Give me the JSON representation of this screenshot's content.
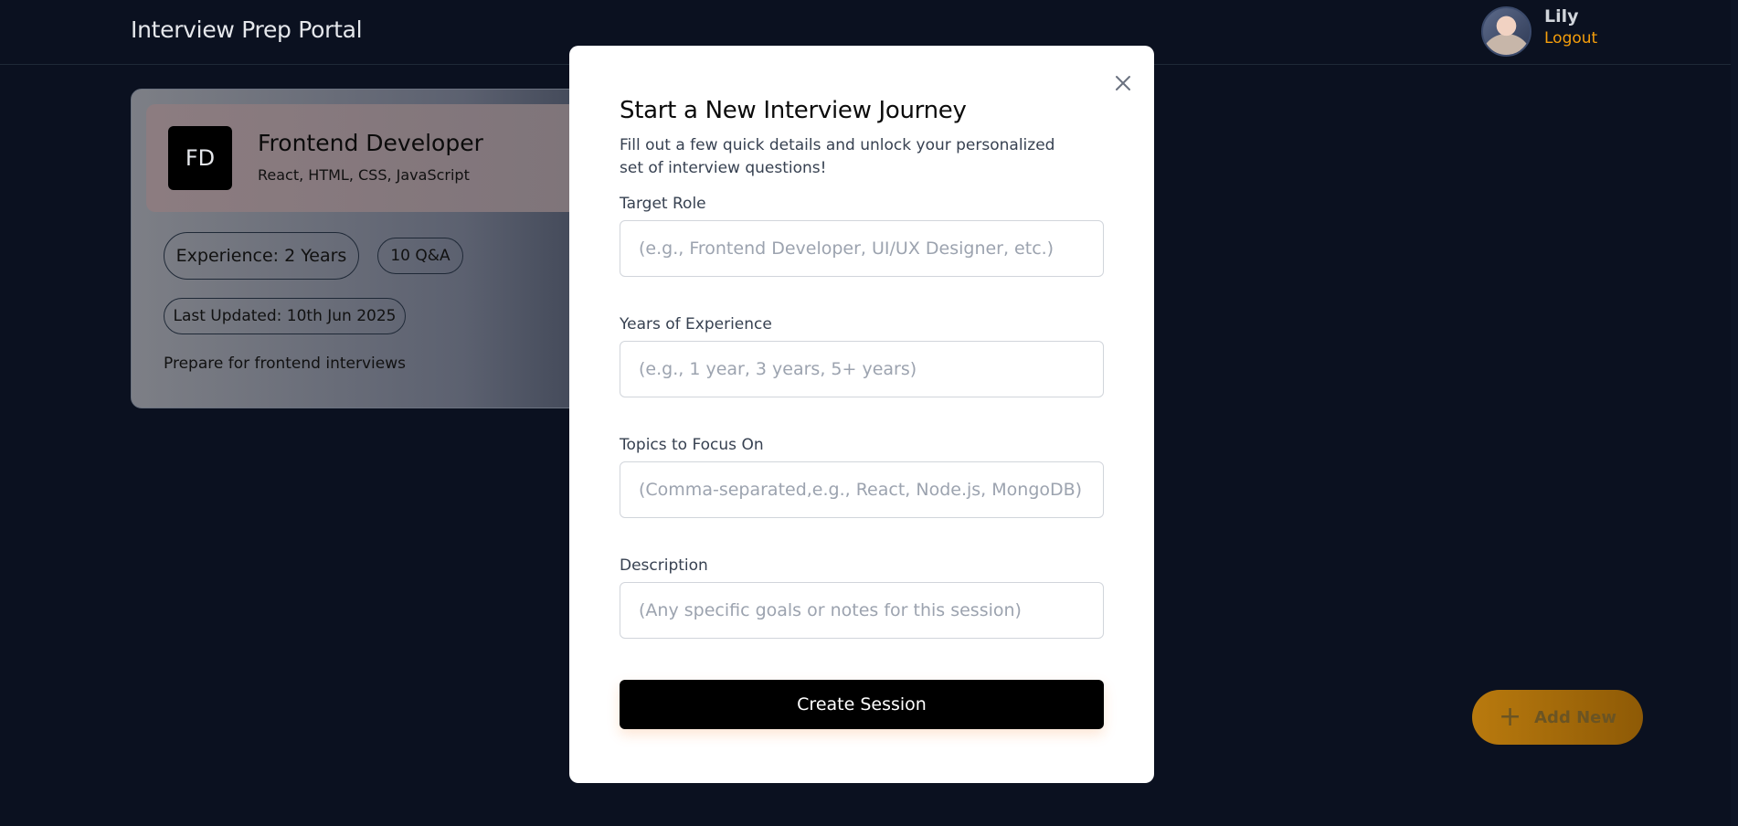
{
  "header": {
    "brand": "Interview Prep Portal",
    "user_name": "Lily",
    "logout_label": "Logout"
  },
  "session_card": {
    "initials": "FD",
    "title": "Frontend Developer",
    "topics": "React, HTML, CSS, JavaScript",
    "experience": "Experience: 2 Years",
    "qa_count": "10 Q&A",
    "last_updated": "Last Updated: 10th Jun 2025",
    "description": "Prepare for frontend interviews"
  },
  "add_new": {
    "icon": "plus-icon",
    "label": "Add New"
  },
  "modal": {
    "title": "Start a New Interview Journey",
    "subtitle": "Fill out a few quick details and unlock your personalized set of interview questions!",
    "close_icon": "close-icon",
    "fields": [
      {
        "label": "Target Role",
        "placeholder": "(e.g., Frontend Developer, UI/UX Designer, etc.)",
        "value": ""
      },
      {
        "label": "Years of Experience",
        "placeholder": "(e.g., 1 year, 3 years, 5+ years)",
        "value": ""
      },
      {
        "label": "Topics to Focus On",
        "placeholder": "(Comma-separated,e.g., React, Node.js, MongoDB)",
        "value": ""
      },
      {
        "label": "Description",
        "placeholder": "(Any specific goals or notes for this session)",
        "value": ""
      }
    ],
    "submit_label": "Create Session"
  },
  "colors": {
    "background": "#0b1120",
    "accent": "#f59e0b",
    "button": "#000000"
  }
}
